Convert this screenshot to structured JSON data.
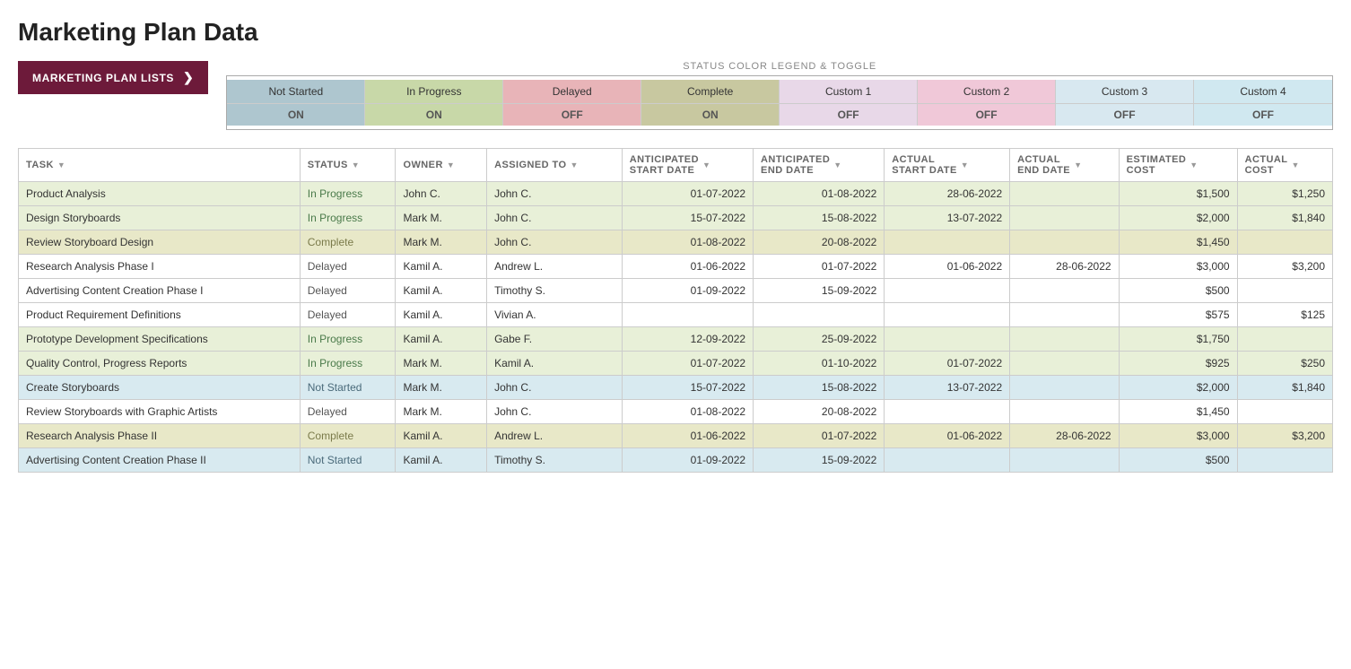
{
  "title": "Marketing Plan Data",
  "sidebar_button": {
    "label": "MARKETING PLAN LISTS",
    "chevron": "❯"
  },
  "legend": {
    "title": "STATUS COLOR LEGEND & TOGGLE",
    "columns": [
      {
        "name": "Not Started",
        "toggle": "ON",
        "headerClass": "not-started-header",
        "toggleClass": "not-started-toggle"
      },
      {
        "name": "In Progress",
        "toggle": "ON",
        "headerClass": "in-progress-header",
        "toggleClass": "in-progress-toggle"
      },
      {
        "name": "Delayed",
        "toggle": "OFF",
        "headerClass": "delayed-header",
        "toggleClass": "delayed-toggle"
      },
      {
        "name": "Complete",
        "toggle": "ON",
        "headerClass": "complete-header",
        "toggleClass": "complete-toggle"
      },
      {
        "name": "Custom 1",
        "toggle": "OFF",
        "headerClass": "custom1-header",
        "toggleClass": "custom1-toggle"
      },
      {
        "name": "Custom 2",
        "toggle": "OFF",
        "headerClass": "custom2-header",
        "toggleClass": "custom2-toggle"
      },
      {
        "name": "Custom 3",
        "toggle": "OFF",
        "headerClass": "custom3-header",
        "toggleClass": "custom3-toggle"
      },
      {
        "name": "Custom 4",
        "toggle": "OFF",
        "headerClass": "custom4-header",
        "toggleClass": "custom4-toggle"
      }
    ]
  },
  "table": {
    "headers": [
      {
        "label": "TASK",
        "sub": ""
      },
      {
        "label": "STATUS",
        "sub": ""
      },
      {
        "label": "OWNER",
        "sub": ""
      },
      {
        "label": "ASSIGNED TO",
        "sub": ""
      },
      {
        "label": "ANTICIPATED\nSTART DATE",
        "sub": ""
      },
      {
        "label": "ANTICIPATED\nEND DATE",
        "sub": ""
      },
      {
        "label": "ACTUAL\nSTART DATE",
        "sub": ""
      },
      {
        "label": "ACTUAL\nEND DATE",
        "sub": ""
      },
      {
        "label": "ESTIMATED\nCOST",
        "sub": ""
      },
      {
        "label": "ACTUAL\nCOST",
        "sub": ""
      }
    ],
    "rows": [
      {
        "task": "Product Analysis",
        "status": "In Progress",
        "owner": "John C.",
        "assigned_to": "John C.",
        "ant_start": "01-07-2022",
        "ant_end": "01-08-2022",
        "act_start": "28-06-2022",
        "act_end": "",
        "est_cost": "$1,500",
        "act_cost": "$1,250",
        "rowClass": "row-in-progress",
        "statusClass": "status-in-progress"
      },
      {
        "task": "Design Storyboards",
        "status": "In Progress",
        "owner": "Mark M.",
        "assigned_to": "John C.",
        "ant_start": "15-07-2022",
        "ant_end": "15-08-2022",
        "act_start": "13-07-2022",
        "act_end": "",
        "est_cost": "$2,000",
        "act_cost": "$1,840",
        "rowClass": "row-in-progress",
        "statusClass": "status-in-progress"
      },
      {
        "task": "Review Storyboard Design",
        "status": "Complete",
        "owner": "Mark M.",
        "assigned_to": "John C.",
        "ant_start": "01-08-2022",
        "ant_end": "20-08-2022",
        "act_start": "",
        "act_end": "",
        "est_cost": "$1,450",
        "act_cost": "",
        "rowClass": "row-complete",
        "statusClass": "status-complete"
      },
      {
        "task": "Research Analysis Phase I",
        "status": "Delayed",
        "owner": "Kamil A.",
        "assigned_to": "Andrew L.",
        "ant_start": "01-06-2022",
        "ant_end": "01-07-2022",
        "act_start": "01-06-2022",
        "act_end": "28-06-2022",
        "est_cost": "$3,000",
        "act_cost": "$3,200",
        "rowClass": "row-delayed",
        "statusClass": "status-delayed"
      },
      {
        "task": "Advertising Content Creation Phase I",
        "status": "Delayed",
        "owner": "Kamil A.",
        "assigned_to": "Timothy S.",
        "ant_start": "01-09-2022",
        "ant_end": "15-09-2022",
        "act_start": "",
        "act_end": "",
        "est_cost": "$500",
        "act_cost": "",
        "rowClass": "row-delayed",
        "statusClass": "status-delayed"
      },
      {
        "task": "Product Requirement Definitions",
        "status": "Delayed",
        "owner": "Kamil A.",
        "assigned_to": "Vivian A.",
        "ant_start": "",
        "ant_end": "",
        "act_start": "",
        "act_end": "",
        "est_cost": "$575",
        "act_cost": "$125",
        "rowClass": "row-delayed",
        "statusClass": "status-delayed"
      },
      {
        "task": "Prototype Development Specifications",
        "status": "In Progress",
        "owner": "Kamil A.",
        "assigned_to": "Gabe F.",
        "ant_start": "12-09-2022",
        "ant_end": "25-09-2022",
        "act_start": "",
        "act_end": "",
        "est_cost": "$1,750",
        "act_cost": "",
        "rowClass": "row-in-progress",
        "statusClass": "status-in-progress"
      },
      {
        "task": "Quality Control, Progress Reports",
        "status": "In Progress",
        "owner": "Mark M.",
        "assigned_to": "Kamil A.",
        "ant_start": "01-07-2022",
        "ant_end": "01-10-2022",
        "act_start": "01-07-2022",
        "act_end": "",
        "est_cost": "$925",
        "act_cost": "$250",
        "rowClass": "row-in-progress",
        "statusClass": "status-in-progress"
      },
      {
        "task": "Create Storyboards",
        "status": "Not Started",
        "owner": "Mark M.",
        "assigned_to": "John C.",
        "ant_start": "15-07-2022",
        "ant_end": "15-08-2022",
        "act_start": "13-07-2022",
        "act_end": "",
        "est_cost": "$2,000",
        "act_cost": "$1,840",
        "rowClass": "row-not-started",
        "statusClass": "status-not-started"
      },
      {
        "task": "Review Storyboards with Graphic Artists",
        "status": "Delayed",
        "owner": "Mark M.",
        "assigned_to": "John C.",
        "ant_start": "01-08-2022",
        "ant_end": "20-08-2022",
        "act_start": "",
        "act_end": "",
        "est_cost": "$1,450",
        "act_cost": "",
        "rowClass": "row-delayed",
        "statusClass": "status-delayed"
      },
      {
        "task": "Research Analysis Phase II",
        "status": "Complete",
        "owner": "Kamil A.",
        "assigned_to": "Andrew L.",
        "ant_start": "01-06-2022",
        "ant_end": "01-07-2022",
        "act_start": "01-06-2022",
        "act_end": "28-06-2022",
        "est_cost": "$3,000",
        "act_cost": "$3,200",
        "rowClass": "row-complete",
        "statusClass": "status-complete"
      },
      {
        "task": "Advertising Content Creation Phase II",
        "status": "Not Started",
        "owner": "Kamil A.",
        "assigned_to": "Timothy S.",
        "ant_start": "01-09-2022",
        "ant_end": "15-09-2022",
        "act_start": "",
        "act_end": "",
        "est_cost": "$500",
        "act_cost": "",
        "rowClass": "row-not-started",
        "statusClass": "status-not-started"
      }
    ]
  }
}
